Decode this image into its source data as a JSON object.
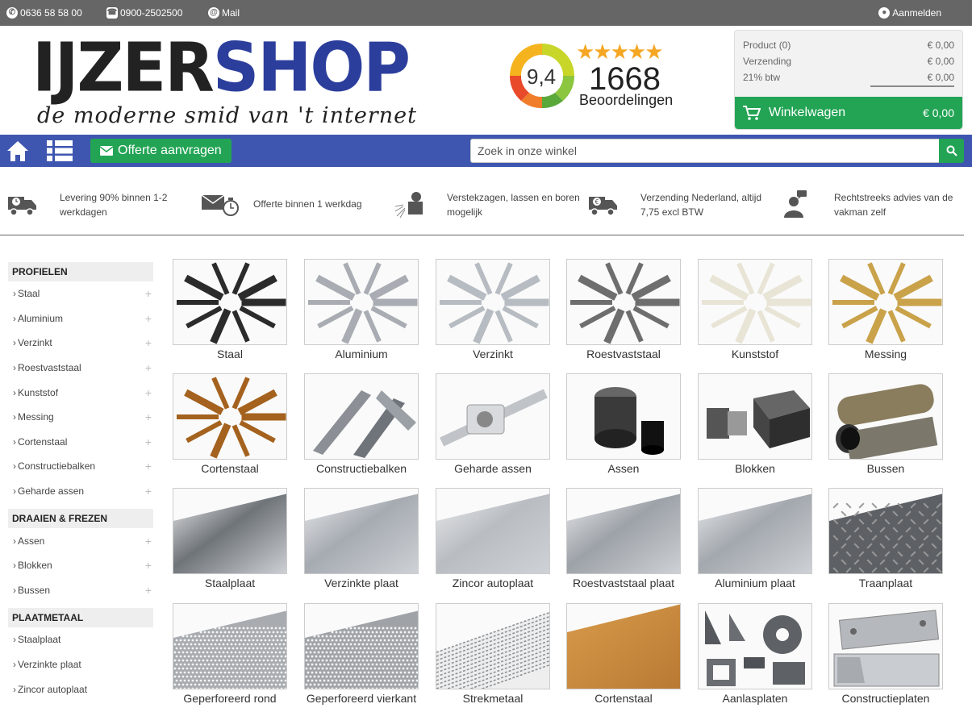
{
  "topbar": {
    "whatsapp": "0636 58 58 00",
    "phone": "0900-2502500",
    "mail": "Mail",
    "login": "Aanmelden"
  },
  "logo": {
    "part1": "IJZER",
    "part2": "SHOP",
    "tagline": "de moderne smid van 't internet"
  },
  "rating": {
    "score": "9,4",
    "stars": "★★★★★",
    "count": "1668",
    "label": "Beoordelingen"
  },
  "cart": {
    "rows": [
      {
        "label": "Product (0)",
        "value": "€ 0,00"
      },
      {
        "label": "Verzending",
        "value": "€ 0,00"
      },
      {
        "label": "21% btw",
        "value": "€ 0,00"
      }
    ],
    "button_label": "Winkelwagen",
    "total": "€ 0,00"
  },
  "nav": {
    "offer_label": "Offerte aanvragen",
    "search_placeholder": "Zoek in onze winkel"
  },
  "usps": [
    {
      "text": "Levering 90% binnen 1-2 werkdagen",
      "icon": "truck-clock-icon"
    },
    {
      "text": "Offerte binnen 1 werkdag",
      "icon": "envelope-clock-icon"
    },
    {
      "text": "Verstekzagen, lassen en boren mogelijk",
      "icon": "welder-icon"
    },
    {
      "text": "Verzending Nederland, altijd 7,75 excl BTW",
      "icon": "truck-euro-icon"
    },
    {
      "text": "Rechtstreeks advies van de vakman zelf",
      "icon": "advisor-icon"
    }
  ],
  "sidebar": {
    "groups": [
      {
        "title": "PROFIELEN",
        "items": [
          "Staal",
          "Aluminium",
          "Verzinkt",
          "Roestvaststaal",
          "Kunststof",
          "Messing",
          "Cortenstaal",
          "Constructiebalken",
          "Geharde assen"
        ],
        "expandable": true
      },
      {
        "title": "DRAAIEN & FREZEN",
        "items": [
          "Assen",
          "Blokken",
          "Bussen"
        ],
        "expandable": true
      },
      {
        "title": "PLAATMETAAL",
        "items": [
          "Staalplaat",
          "Verzinkte plaat",
          "Zincor autoplaat"
        ],
        "expandable": false
      }
    ]
  },
  "products": [
    {
      "label": "Staal",
      "kind": "profiles",
      "color": "#2b2b2b"
    },
    {
      "label": "Aluminium",
      "kind": "profiles",
      "color": "#a9adb3"
    },
    {
      "label": "Verzinkt",
      "kind": "profiles",
      "color": "#b7bcc2"
    },
    {
      "label": "Roestvaststaal",
      "kind": "profiles",
      "color": "#6e6e6e"
    },
    {
      "label": "Kunststof",
      "kind": "profiles",
      "color": "#e8e4d6"
    },
    {
      "label": "Messing",
      "kind": "profiles",
      "color": "#c9a24a"
    },
    {
      "label": "Cortenstaal",
      "kind": "profiles",
      "color": "#a4621e"
    },
    {
      "label": "Constructiebalken",
      "kind": "beams",
      "color": "#8c9096"
    },
    {
      "label": "Geharde assen",
      "kind": "shaft",
      "color": "#c0c4c8"
    },
    {
      "label": "Assen",
      "kind": "rods",
      "color": "#3a3a3a"
    },
    {
      "label": "Blokken",
      "kind": "blocks",
      "color": "#454545"
    },
    {
      "label": "Bussen",
      "kind": "tubes",
      "color": "#8a7d5e"
    },
    {
      "label": "Staalplaat",
      "kind": "sheet",
      "color": "#6f7479"
    },
    {
      "label": "Verzinkte plaat",
      "kind": "sheet",
      "color": "#a6abb2"
    },
    {
      "label": "Zincor autoplaat",
      "kind": "sheet",
      "color": "#b9bdc2"
    },
    {
      "label": "Roestvaststaal plaat",
      "kind": "sheet",
      "color": "#9da2a8"
    },
    {
      "label": "Aluminium plaat",
      "kind": "sheet",
      "color": "#a3a8ae"
    },
    {
      "label": "Traanplaat",
      "kind": "tread",
      "color": "#5d6166"
    },
    {
      "label": "Geperforeerd rond",
      "kind": "perf",
      "color": "#a8acb1"
    },
    {
      "label": "Geperforeerd vierkant",
      "kind": "perf",
      "color": "#9fa3a8"
    },
    {
      "label": "Strekmetaal",
      "kind": "mesh",
      "color": "#8e9297"
    },
    {
      "label": "Cortenstaal",
      "kind": "corten",
      "color": "#b87a33"
    },
    {
      "label": "Aanlasplaten",
      "kind": "plates",
      "color": "#55585c"
    },
    {
      "label": "Constructieplaten",
      "kind": "cplates",
      "color": "#b5b8bc"
    }
  ]
}
